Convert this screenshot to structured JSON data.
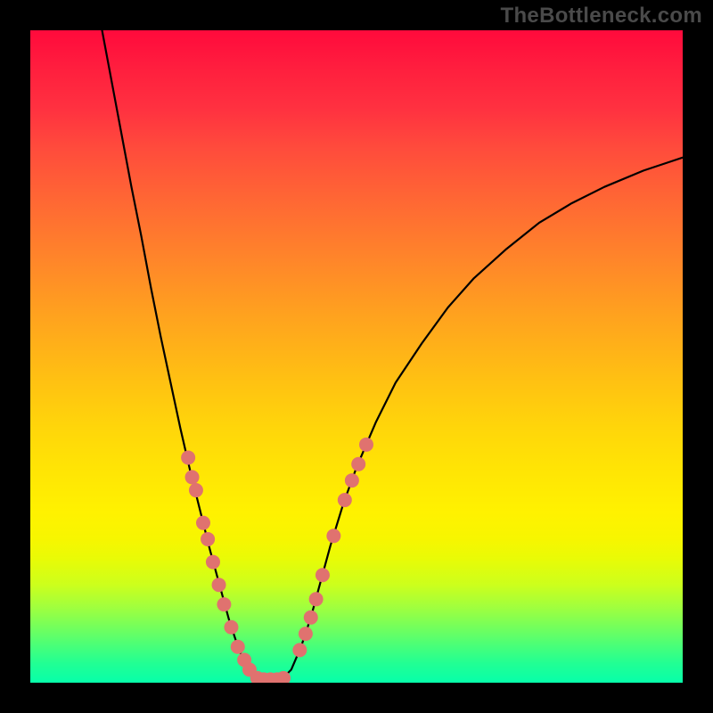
{
  "watermark": "TheBottleneck.com",
  "chart_data": {
    "type": "line",
    "title": "",
    "xlabel": "",
    "ylabel": "",
    "xlim": [
      0,
      100
    ],
    "ylim": [
      0,
      100
    ],
    "curve": [
      {
        "x": 11.0,
        "y": 100.0
      },
      {
        "x": 12.5,
        "y": 92.0
      },
      {
        "x": 14.0,
        "y": 84.0
      },
      {
        "x": 15.5,
        "y": 76.0
      },
      {
        "x": 17.0,
        "y": 68.5
      },
      {
        "x": 18.5,
        "y": 60.5
      },
      {
        "x": 20.0,
        "y": 53.0
      },
      {
        "x": 21.5,
        "y": 46.0
      },
      {
        "x": 23.0,
        "y": 39.0
      },
      {
        "x": 24.5,
        "y": 32.5
      },
      {
        "x": 26.0,
        "y": 26.5
      },
      {
        "x": 27.5,
        "y": 20.5
      },
      {
        "x": 29.0,
        "y": 15.0
      },
      {
        "x": 30.5,
        "y": 9.5
      },
      {
        "x": 32.0,
        "y": 5.0
      },
      {
        "x": 33.5,
        "y": 2.0
      },
      {
        "x": 34.5,
        "y": 0.6
      },
      {
        "x": 35.5,
        "y": 0.3
      },
      {
        "x": 37.0,
        "y": 0.3
      },
      {
        "x": 38.5,
        "y": 0.5
      },
      {
        "x": 40.0,
        "y": 2.0
      },
      {
        "x": 41.5,
        "y": 5.5
      },
      {
        "x": 43.0,
        "y": 10.0
      },
      {
        "x": 44.5,
        "y": 15.5
      },
      {
        "x": 46.0,
        "y": 21.0
      },
      {
        "x": 48.0,
        "y": 27.5
      },
      {
        "x": 50.0,
        "y": 33.0
      },
      {
        "x": 53.0,
        "y": 40.0
      },
      {
        "x": 56.0,
        "y": 46.0
      },
      {
        "x": 60.0,
        "y": 52.0
      },
      {
        "x": 64.0,
        "y": 57.5
      },
      {
        "x": 68.0,
        "y": 62.0
      },
      {
        "x": 73.0,
        "y": 66.5
      },
      {
        "x": 78.0,
        "y": 70.5
      },
      {
        "x": 83.0,
        "y": 73.5
      },
      {
        "x": 88.0,
        "y": 76.0
      },
      {
        "x": 94.0,
        "y": 78.5
      },
      {
        "x": 100.0,
        "y": 80.5
      }
    ],
    "marker_groups": {
      "left": [
        {
          "x": 24.2,
          "y": 34.5
        },
        {
          "x": 24.8,
          "y": 31.5
        },
        {
          "x": 25.4,
          "y": 29.5
        },
        {
          "x": 26.5,
          "y": 24.5
        },
        {
          "x": 27.2,
          "y": 22.0
        },
        {
          "x": 28.0,
          "y": 18.5
        },
        {
          "x": 28.9,
          "y": 15.0
        },
        {
          "x": 29.7,
          "y": 12.0
        },
        {
          "x": 30.8,
          "y": 8.5
        },
        {
          "x": 31.8,
          "y": 5.5
        },
        {
          "x": 32.8,
          "y": 3.5
        },
        {
          "x": 33.6,
          "y": 2.0
        }
      ],
      "bottom": [
        {
          "x": 34.8,
          "y": 0.7
        },
        {
          "x": 35.8,
          "y": 0.5
        },
        {
          "x": 36.8,
          "y": 0.5
        },
        {
          "x": 37.8,
          "y": 0.5
        },
        {
          "x": 38.8,
          "y": 0.7
        }
      ],
      "right": [
        {
          "x": 41.3,
          "y": 5.0
        },
        {
          "x": 42.2,
          "y": 7.5
        },
        {
          "x": 43.0,
          "y": 10.0
        },
        {
          "x": 43.8,
          "y": 12.8
        },
        {
          "x": 44.8,
          "y": 16.5
        },
        {
          "x": 46.5,
          "y": 22.5
        },
        {
          "x": 48.2,
          "y": 28.0
        },
        {
          "x": 49.3,
          "y": 31.0
        },
        {
          "x": 50.3,
          "y": 33.5
        },
        {
          "x": 51.5,
          "y": 36.5
        }
      ]
    },
    "marker_color": "#e0726f",
    "curve_color": "#000000"
  }
}
